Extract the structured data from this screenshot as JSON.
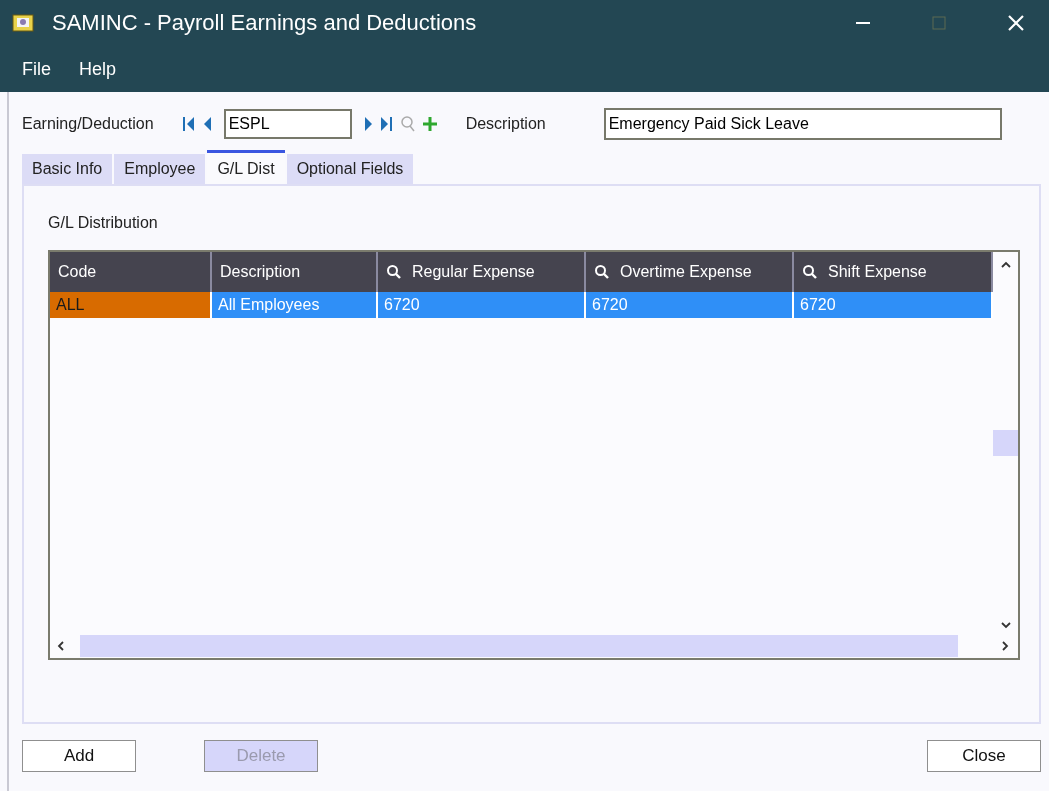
{
  "window": {
    "title": "SAMINC - Payroll Earnings and Deductions"
  },
  "menu": [
    {
      "label": "File"
    },
    {
      "label": "Help"
    }
  ],
  "header": {
    "code_label": "Earning/Deduction",
    "code_value": "ESPL",
    "description_label": "Description",
    "description_value": "Emergency Paid Sick Leave"
  },
  "tabs": [
    {
      "label": "Basic Info",
      "selected": false
    },
    {
      "label": "Employee",
      "selected": false
    },
    {
      "label": "G/L Dist",
      "selected": true
    },
    {
      "label": "Optional Fields",
      "selected": false
    }
  ],
  "section_title": "G/L Distribution",
  "table": {
    "columns": [
      {
        "label": "Code",
        "lookup": false
      },
      {
        "label": "Description",
        "lookup": false
      },
      {
        "label": "Regular Expense",
        "lookup": true
      },
      {
        "label": "Overtime Expense",
        "lookup": true
      },
      {
        "label": "Shift Expense",
        "lookup": true
      }
    ],
    "rows": [
      {
        "selected": true,
        "cells": [
          {
            "text": "ALL",
            "focused": true
          },
          {
            "text": "All Employees",
            "focused": false
          },
          {
            "text": "6720",
            "focused": false
          },
          {
            "text": "6720",
            "focused": false
          },
          {
            "text": "6720",
            "focused": false
          }
        ]
      }
    ]
  },
  "buttons": [
    {
      "label": "Add",
      "disabled": false
    },
    {
      "label": "Delete",
      "disabled": true
    },
    {
      "label": "Close",
      "disabled": false
    }
  ]
}
